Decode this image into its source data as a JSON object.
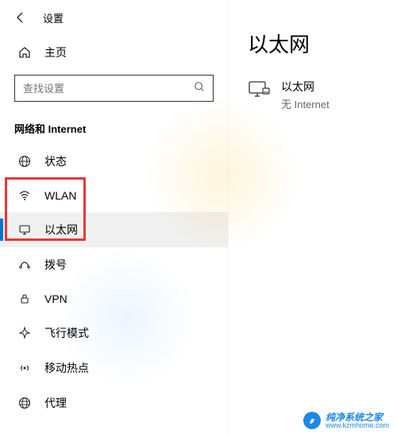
{
  "header": {
    "title": "设置"
  },
  "home": {
    "label": "主页"
  },
  "search": {
    "placeholder": "查找设置"
  },
  "category": {
    "title": "网络和 Internet"
  },
  "nav": {
    "items": [
      {
        "icon": "status",
        "label": "状态"
      },
      {
        "icon": "wifi",
        "label": "WLAN"
      },
      {
        "icon": "ethernet",
        "label": "以太网"
      },
      {
        "icon": "dialup",
        "label": "拨号"
      },
      {
        "icon": "vpn",
        "label": "VPN"
      },
      {
        "icon": "airplane",
        "label": "飞行模式"
      },
      {
        "icon": "hotspot",
        "label": "移动热点"
      },
      {
        "icon": "proxy",
        "label": "代理"
      }
    ],
    "selected_index": 2
  },
  "main": {
    "title": "以太网",
    "connection": {
      "name": "以太网",
      "status": "无 Internet"
    }
  },
  "watermark": {
    "cn": "纯净系统之家",
    "url": "www.kzmhome.com"
  }
}
